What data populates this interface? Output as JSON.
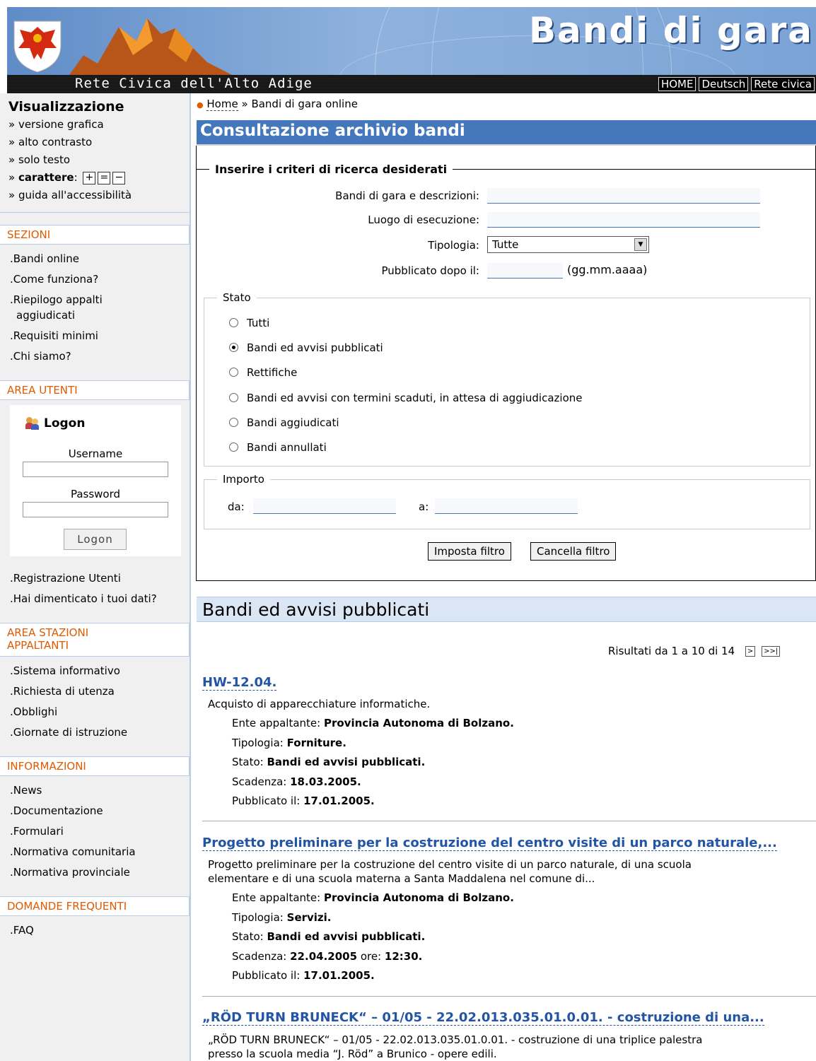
{
  "header": {
    "title": "Bandi di gara",
    "subtitle": "Rete Civica dell'Alto Adige",
    "links": [
      "HOME",
      "Deutsch",
      "Rete civica"
    ]
  },
  "sidebar": {
    "vis_title": "Visualizzazione",
    "vis_items": [
      "» versione grafica",
      "» alto contrasto",
      "» solo testo"
    ],
    "carattere_prefix": "» ",
    "carattere_label": "carattere",
    "carattere_colon": ":",
    "font_buttons": [
      "+",
      "=",
      "−"
    ],
    "guide": "» guida all'accessibilità",
    "sezioni": {
      "title": "SEZIONI",
      "items": [
        ".Bandi online",
        ".Come funziona?",
        ".Riepilogo appalti",
        "aggiudicati",
        ".Requisiti minimi",
        ".Chi siamo?"
      ]
    },
    "area_utenti": {
      "title": "AREA UTENTI",
      "logon_title": "Logon",
      "username_label": "Username",
      "password_label": "Password",
      "logon_button": "Logon",
      "links": [
        ".Registrazione Utenti",
        ".Hai dimenticato i tuoi dati?"
      ]
    },
    "area_stazioni": {
      "title1": "AREA STAZIONI",
      "title2": "APPALTANTI",
      "items": [
        ".Sistema informativo",
        ".Richiesta di utenza",
        ".Obblighi",
        ".Giornate di istruzione"
      ]
    },
    "informazioni": {
      "title": "INFORMAZIONI",
      "items": [
        ".News",
        ".Documentazione",
        ".Formulari",
        ".Normativa comunitaria",
        ".Normativa provinciale"
      ]
    },
    "domande": {
      "title": "DOMANDE FREQUENTI",
      "items": [
        ".FAQ"
      ]
    }
  },
  "breadcrumb": {
    "home": "Home",
    "sep": "»",
    "current": "Bandi di gara online"
  },
  "page_title": "Consultazione archivio bandi",
  "form": {
    "legend": "Inserire i criteri di ricerca desiderati",
    "bandi_label": "Bandi di gara e descrizioni:",
    "bandi_value": "",
    "luogo_label": "Luogo di esecuzione:",
    "luogo_value": "",
    "tipologia_label": "Tipologia:",
    "tipologia_value": "Tutte",
    "pubblicato_label": "Pubblicato dopo il:",
    "pubblicato_value": "",
    "date_hint": "(gg.mm.aaaa)",
    "stato_legend": "Stato",
    "stato_options": [
      "Tutti",
      "Bandi ed avvisi pubblicati",
      "Rettifiche",
      "Bandi ed avvisi con termini scaduti, in attesa di aggiudicazione",
      "Bandi aggiudicati",
      "Bandi annullati"
    ],
    "stato_selected": 1,
    "importo_legend": "Importo",
    "da_label": "da:",
    "a_label": "a:",
    "btn_apply": "Imposta filtro",
    "btn_clear": "Cancella filtro"
  },
  "results": {
    "title": "Bandi ed avvisi pubblicati",
    "pager": "Risultati da 1 a 10 di 14",
    "next": ">",
    "last": ">>|",
    "entries": [
      {
        "title": "HW-12.04.",
        "desc": "Acquisto di apparecchiature informatiche.",
        "ente_label": "Ente appaltante:",
        "ente": "Provincia Autonoma di Bolzano.",
        "tipo_label": "Tipologia:",
        "tipo": "Forniture.",
        "stato_label": "Stato:",
        "stato": "Bandi ed avvisi pubblicati.",
        "scad_label": "Scadenza:",
        "scad": "18.03.2005.",
        "pub_label": "Pubblicato il:",
        "pub": "17.01.2005."
      },
      {
        "title": "Progetto preliminare per la costruzione del centro visite di un parco naturale,...",
        "desc1": "Progetto preliminare per la costruzione del centro visite di un parco naturale, di una scuola",
        "desc2": "elementare e di una scuola materna a Santa Maddalena nel comune di...",
        "ente_label": "Ente appaltante:",
        "ente": "Provincia Autonoma di Bolzano.",
        "tipo_label": "Tipologia:",
        "tipo": "Servizi.",
        "stato_label": "Stato:",
        "stato": "Bandi ed avvisi pubblicati.",
        "scad_label": "Scadenza:",
        "scad": "22.04.2005",
        "ore_label": "ore:",
        "ore": "12:30.",
        "pub_label": "Pubblicato il:",
        "pub": "17.01.2005."
      },
      {
        "title": "„RÖD TURN BRUNECK“ – 01/05 - 22.02.013.035.01.0.01. - costruzione di una...",
        "desc1": "„RÖD TURN BRUNECK“ – 01/05 - 22.02.013.035.01.0.01. - costruzione di una triplice palestra",
        "desc2": "presso la scuola media “J. Röd” a Brunico - opere edili."
      }
    ]
  },
  "colors": {
    "accent": "#4477bb",
    "section_head": "#e05a00",
    "link": "#2255a4"
  }
}
